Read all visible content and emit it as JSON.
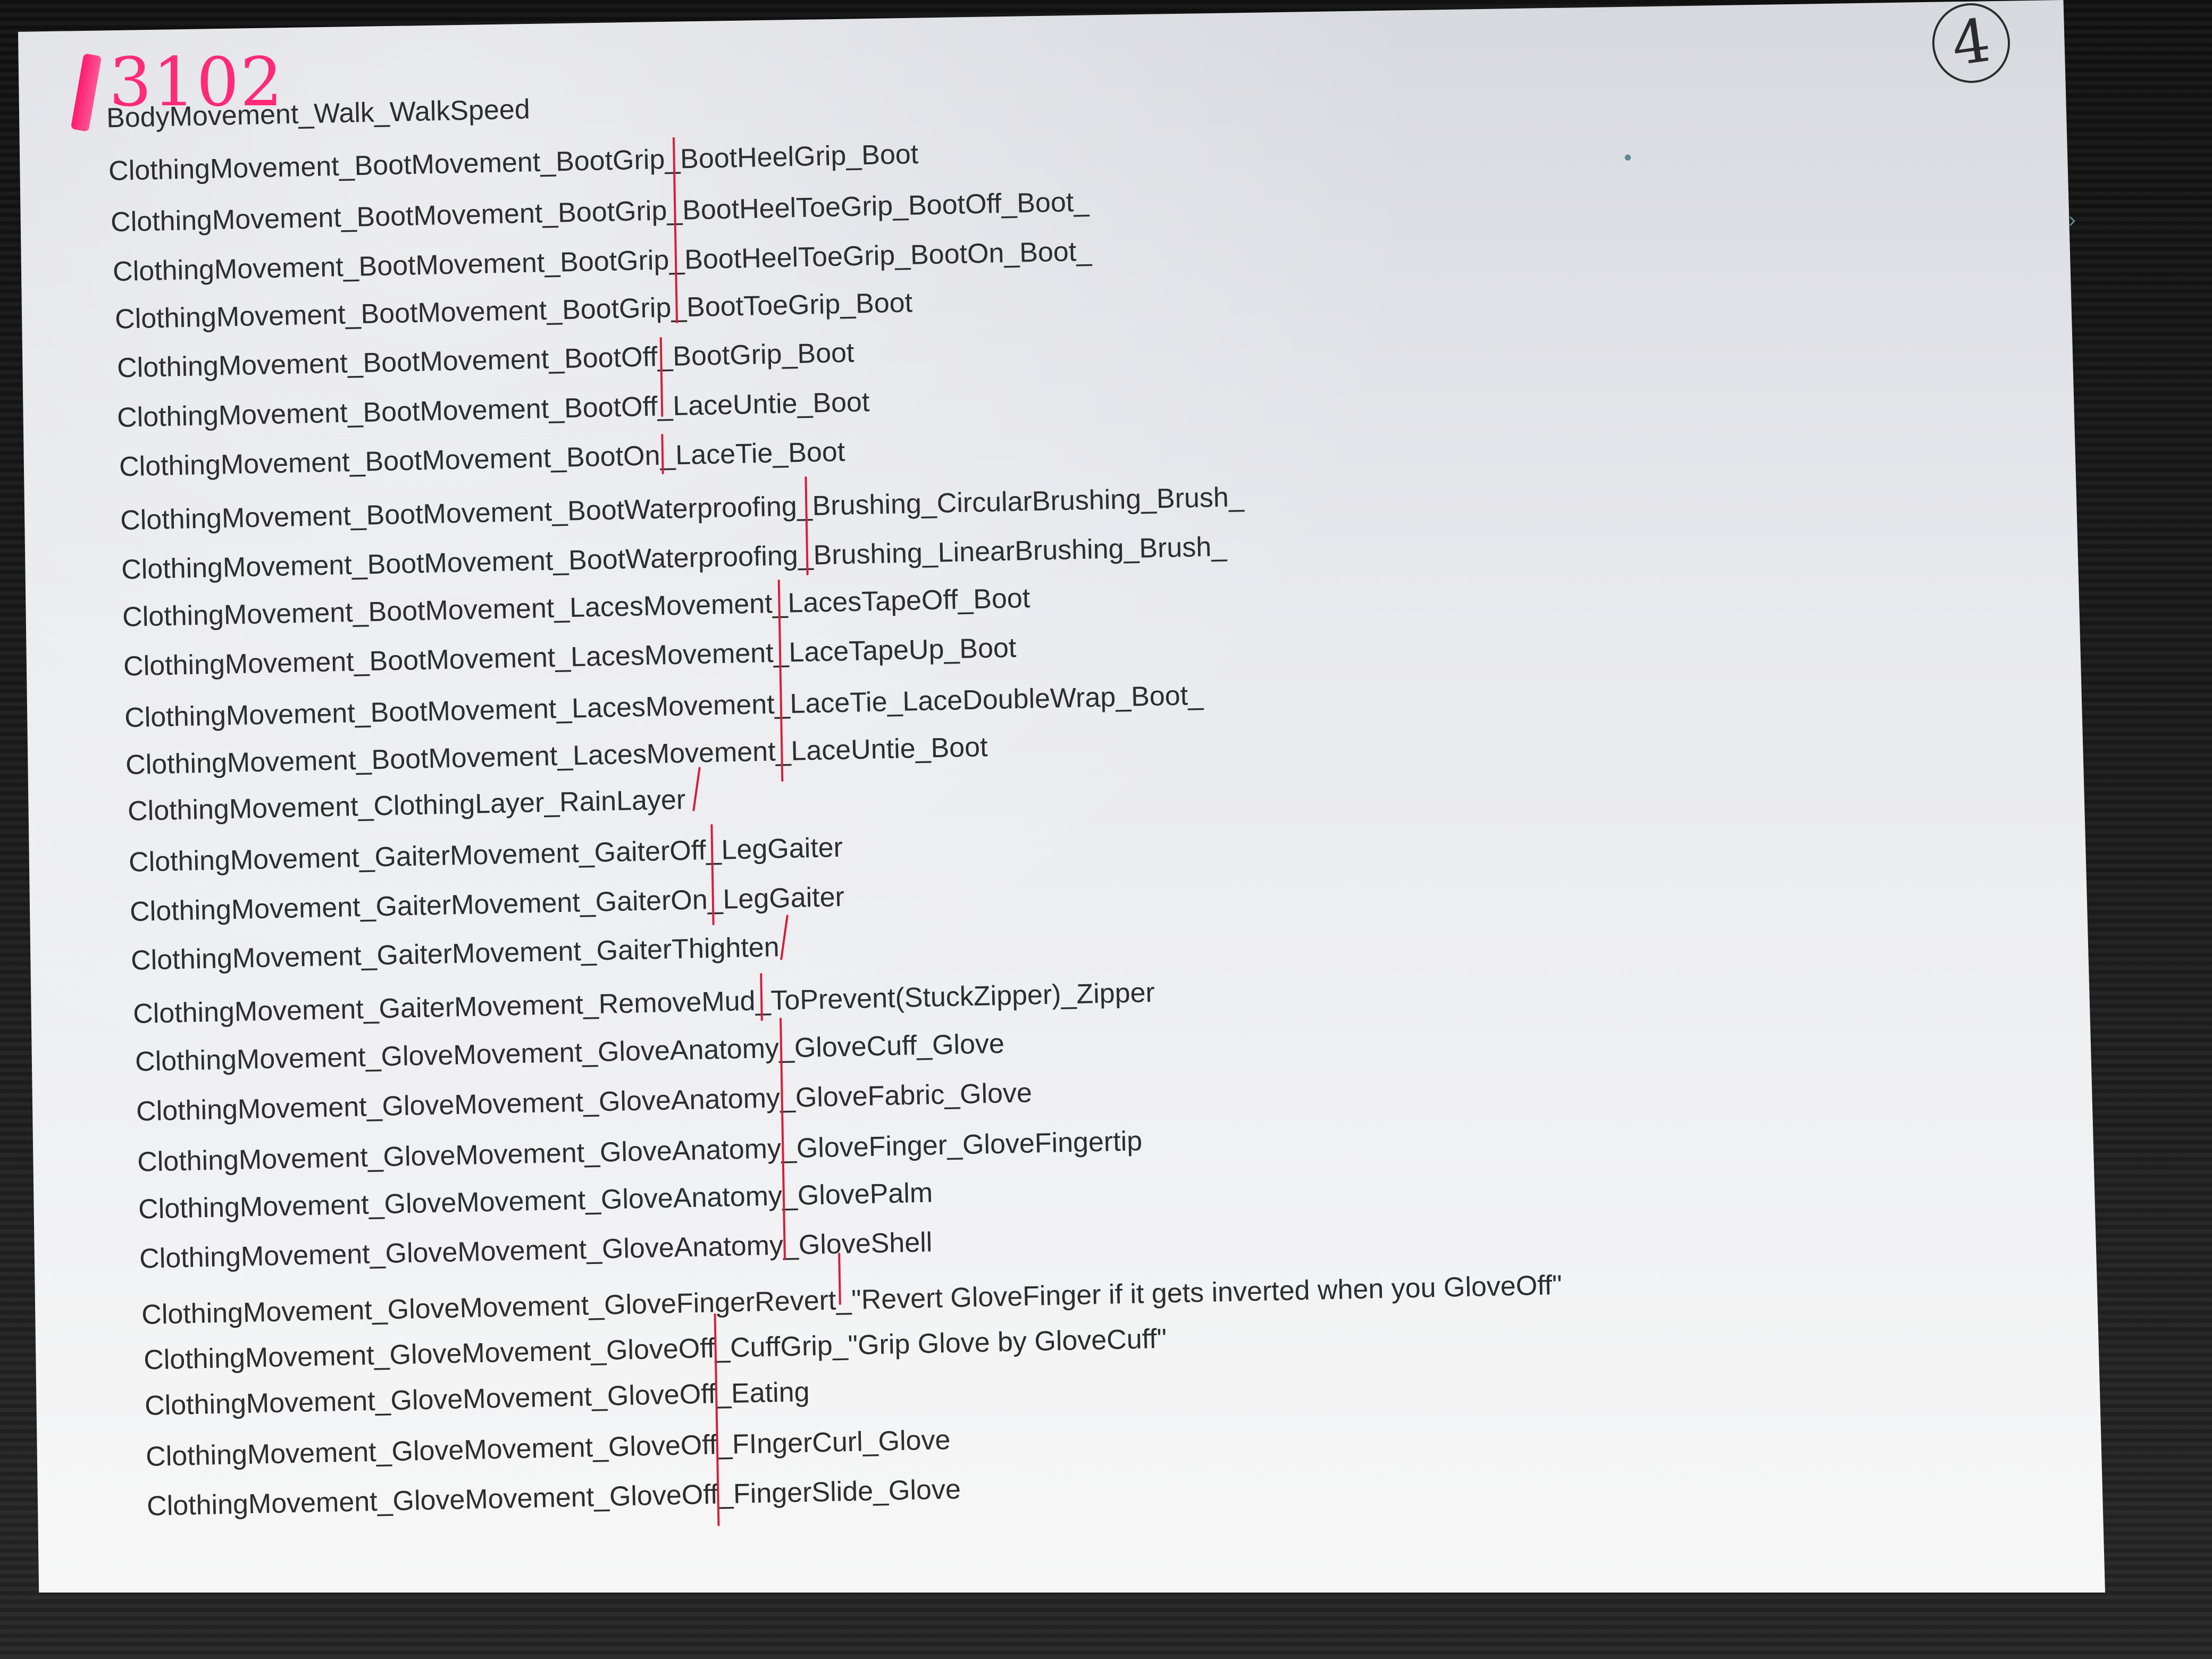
{
  "page": {
    "handwritten_number": "3102",
    "page_number": "4",
    "entries": [
      "BodyMovement_Walk_WalkSpeed",
      "ClothingMovement_BootMovement_BootGrip_BootHeelGrip_Boot",
      "ClothingMovement_BootMovement_BootGrip_BootHeelToeGrip_BootOff_Boot_",
      "ClothingMovement_BootMovement_BootGrip_BootHeelToeGrip_BootOn_Boot_",
      "ClothingMovement_BootMovement_BootGrip_BootToeGrip_Boot",
      "ClothingMovement_BootMovement_BootOff_BootGrip_Boot",
      "ClothingMovement_BootMovement_BootOff_LaceUntie_Boot",
      "ClothingMovement_BootMovement_BootOn_LaceTie_Boot",
      "ClothingMovement_BootMovement_BootWaterproofing_Brushing_CircularBrushing_Brush_",
      "ClothingMovement_BootMovement_BootWaterproofing_Brushing_LinearBrushing_Brush_",
      "ClothingMovement_BootMovement_LacesMovement_LacesTapeOff_Boot",
      "ClothingMovement_BootMovement_LacesMovement_LaceTapeUp_Boot",
      "ClothingMovement_BootMovement_LacesMovement_LaceTie_LaceDoubleWrap_Boot_",
      "ClothingMovement_BootMovement_LacesMovement_LaceUntie_Boot",
      "ClothingMovement_ClothingLayer_RainLayer",
      "ClothingMovement_GaiterMovement_GaiterOff_LegGaiter",
      "ClothingMovement_GaiterMovement_GaiterOn_LegGaiter",
      "ClothingMovement_GaiterMovement_GaiterThighten",
      "ClothingMovement_GaiterMovement_RemoveMud_ToPrevent(StuckZipper)_Zipper",
      "ClothingMovement_GloveMovement_GloveAnatomy_GloveCuff_Glove",
      "ClothingMovement_GloveMovement_GloveAnatomy_GloveFabric_Glove",
      "ClothingMovement_GloveMovement_GloveAnatomy_GloveFinger_GloveFingertip",
      "ClothingMovement_GloveMovement_GloveAnatomy_GlovePalm",
      "ClothingMovement_GloveMovement_GloveAnatomy_GloveShell",
      "ClothingMovement_GloveMovement_GloveFingerRevert_\"Revert GloveFinger if it gets inverted when you GloveOff\"",
      "ClothingMovement_GloveMovement_GloveOff_CuffGrip_\"Grip Glove by GloveCuff\"",
      "ClothingMovement_GloveMovement_GloveOff_Eating",
      "ClothingMovement_GloveMovement_GloveOff_FIngerCurl_Glove",
      "ClothingMovement_GloveMovement_GloveOff_FingerSlide_Glove"
    ]
  }
}
